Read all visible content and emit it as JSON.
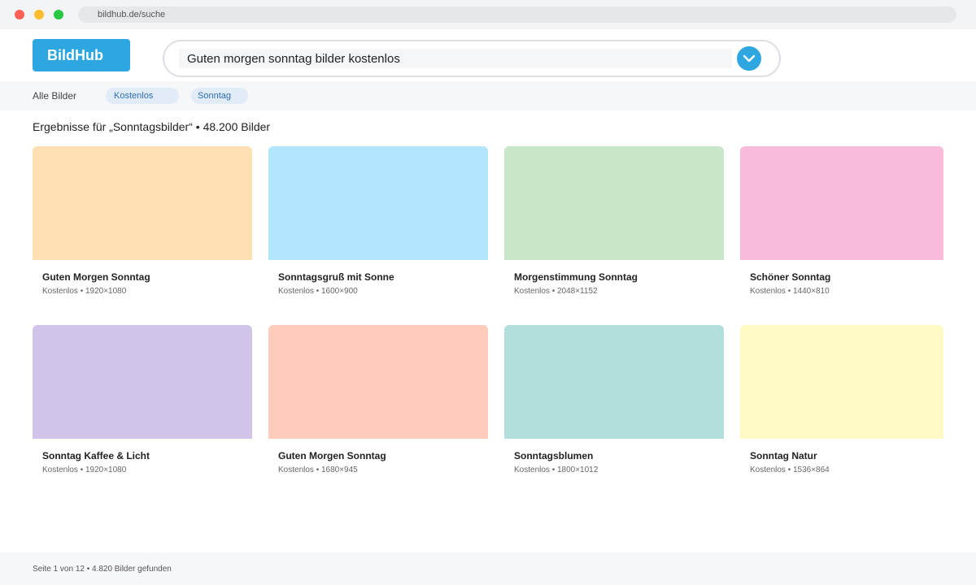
{
  "browser": {
    "url": "bildhub.de/suche"
  },
  "header": {
    "logo": "BildHub",
    "search_value": "Guten morgen sonntag bilder kostenlos",
    "search_icon": "chevron-down-icon"
  },
  "filters": {
    "all_label": "Alle Bilder",
    "chips": [
      "Kostenlos",
      "Sonntag"
    ]
  },
  "results": {
    "heading": "Ergebnisse für „Sonntagsbilder“ • 48.200 Bilder",
    "cards": [
      {
        "title": "Guten Morgen Sonntag",
        "meta": "Kostenlos • 1920×1080",
        "color": "#ffe0b2"
      },
      {
        "title": "Sonntagsgruß mit Sonne",
        "meta": "Kostenlos • 1600×900",
        "color": "#b3e5fc"
      },
      {
        "title": "Morgenstimmung Sonntag",
        "meta": "Kostenlos • 2048×1152",
        "color": "#c8e6c9"
      },
      {
        "title": "Schöner Sonntag",
        "meta": "Kostenlos • 1440×810",
        "color": "#f8bbd9"
      },
      {
        "title": "Sonntag Kaffee & Licht",
        "meta": "Kostenlos • 1920×1080",
        "color": "#d1c4e9"
      },
      {
        "title": "Guten Morgen Sonntag",
        "meta": "Kostenlos • 1680×945",
        "color": "#ffccbc"
      },
      {
        "title": "Sonntagsblumen",
        "meta": "Kostenlos • 1800×1012",
        "color": "#b2dfdb"
      },
      {
        "title": "Sonntag Natur",
        "meta": "Kostenlos • 1536×864",
        "color": "#fff9c4"
      }
    ]
  },
  "footer": {
    "text": "Seite 1 von 12 • 4.820 Bilder gefunden"
  },
  "colors": {
    "accent": "#2ea7e0",
    "chip_text": "#2a6db5"
  }
}
